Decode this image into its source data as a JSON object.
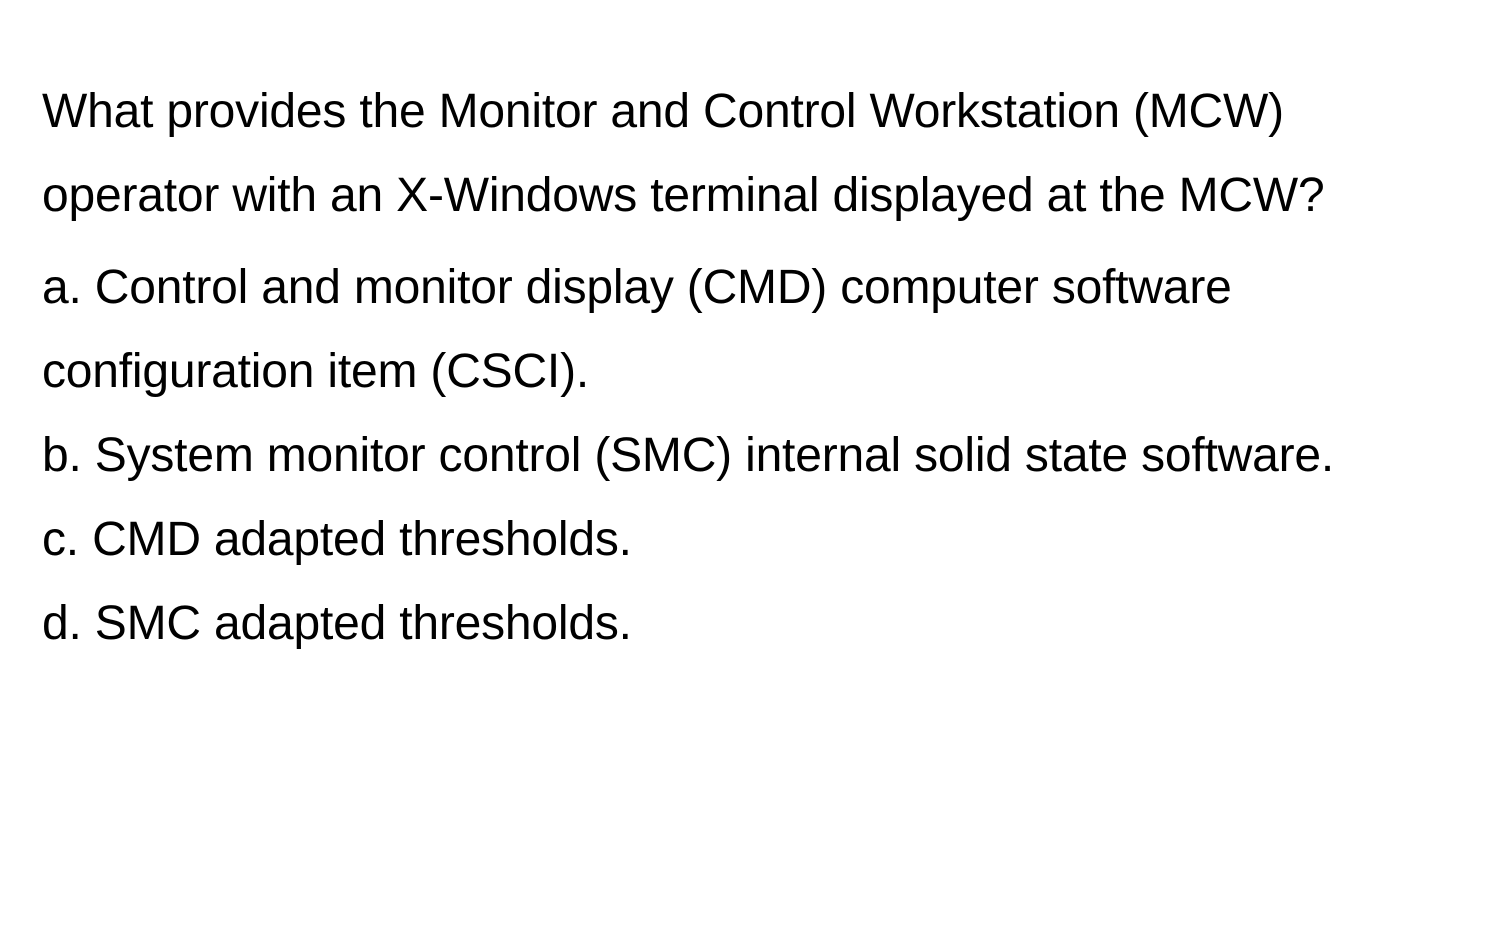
{
  "question": "What provides the Monitor and Control Workstation (MCW) operator with an X-Windows terminal displayed at the MCW?",
  "options": {
    "a": "a. Control and monitor display (CMD) computer software configuration item (CSCI).",
    "b": "b. System monitor control (SMC) internal solid state software.",
    "c": "c. CMD adapted thresholds.",
    "d": "d. SMC adapted thresholds."
  }
}
